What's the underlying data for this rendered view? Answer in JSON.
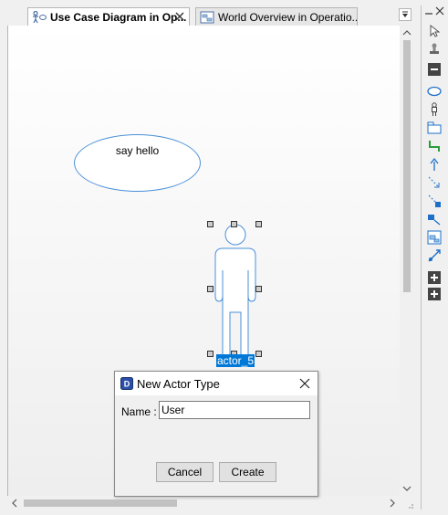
{
  "tabs": [
    {
      "label": "Use Case Diagram in Op...",
      "active": true,
      "icon": "use-case-diagram-icon"
    },
    {
      "label": "World Overview in Operatio...",
      "active": false,
      "icon": "world-overview-icon"
    }
  ],
  "diagram": {
    "use_case": {
      "label": "say hello"
    },
    "actor": {
      "label": "actor_5",
      "selected": true
    }
  },
  "toolbox": {
    "tools": [
      "pointer-icon",
      "stamp-icon",
      "collapse-icon",
      "use-case-ellipse-icon",
      "actor-icon",
      "package-icon",
      "connector-icon",
      "generalization-icon",
      "dependency-icon",
      "include-icon",
      "extend-icon",
      "boundary-icon",
      "note-link-icon",
      "expand-icon",
      "expand-icon"
    ]
  },
  "dialog": {
    "title": "New Actor Type",
    "name_label": "Name :",
    "name_value": "User",
    "cancel_label": "Cancel",
    "create_label": "Create"
  },
  "colors": {
    "accent": "#0078d7",
    "shape_stroke": "#4a90d9"
  }
}
